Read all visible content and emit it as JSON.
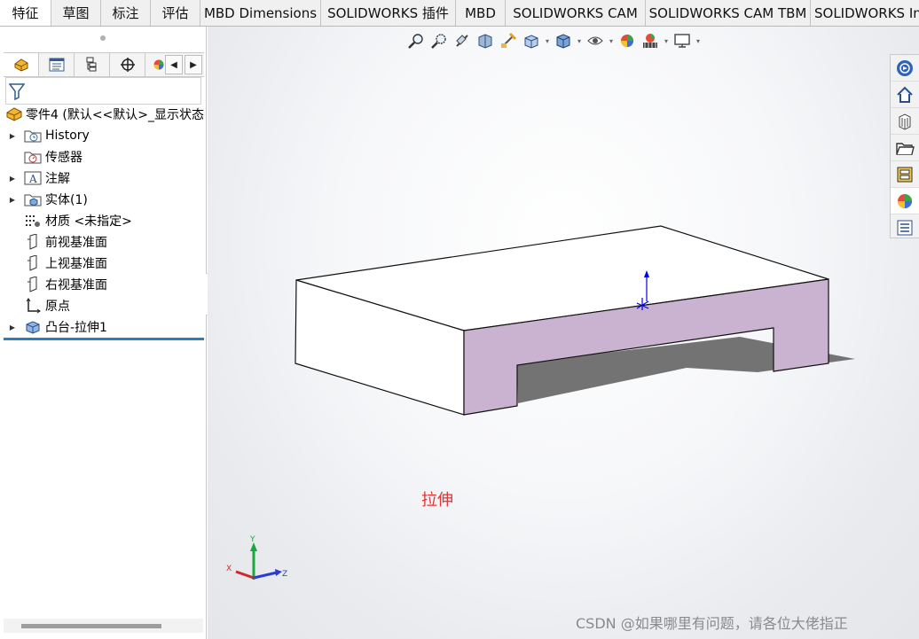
{
  "tabs": [
    {
      "label": "特征",
      "active": true
    },
    {
      "label": "草图"
    },
    {
      "label": "标注"
    },
    {
      "label": "评估"
    },
    {
      "label": "MBD Dimensions"
    },
    {
      "label": "SOLIDWORKS 插件"
    },
    {
      "label": "MBD"
    },
    {
      "label": "SOLIDWORKS CAM"
    },
    {
      "label": "SOLIDWORKS CAM TBM"
    },
    {
      "label": "SOLIDWORKS In..."
    }
  ],
  "panel": {
    "tab_icons": [
      "feature-manager-icon",
      "property-manager-icon",
      "configuration-manager-icon",
      "dimxpert-icon",
      "display-manager-icon"
    ],
    "root_label": "零件4  (默认<<默认>_显示状态",
    "items": [
      {
        "label": "History",
        "expandable": true,
        "icon": "history-folder-icon"
      },
      {
        "label": "传感器",
        "expandable": false,
        "icon": "sensor-folder-icon"
      },
      {
        "label": "注解",
        "expandable": true,
        "icon": "annotations-folder-icon"
      },
      {
        "label": "实体(1)",
        "expandable": true,
        "icon": "solid-bodies-folder-icon"
      },
      {
        "label": "材质 <未指定>",
        "expandable": false,
        "icon": "material-icon"
      },
      {
        "label": "前视基准面",
        "expandable": false,
        "icon": "plane-icon"
      },
      {
        "label": "上视基准面",
        "expandable": false,
        "icon": "plane-icon"
      },
      {
        "label": "右视基准面",
        "expandable": false,
        "icon": "plane-icon"
      },
      {
        "label": "原点",
        "expandable": false,
        "icon": "origin-icon"
      },
      {
        "label": "凸台-拉伸1",
        "expandable": true,
        "icon": "boss-extrude-icon"
      }
    ]
  },
  "headsup_toolbar": [
    "zoom-to-fit-icon",
    "zoom-to-area-icon",
    "previous-view-icon",
    "section-view-icon",
    "dynamic-annotation-icon",
    "view-orientation-icon",
    "display-style-icon",
    "hide-show-items-icon",
    "edit-appearance-icon",
    "apply-scene-icon",
    "view-settings-icon"
  ],
  "task_pane": [
    "solidworks-resources-icon",
    "home-icon",
    "design-library-icon",
    "file-explorer-icon",
    "view-palette-icon",
    "appearances-icon",
    "custom-properties-icon"
  ],
  "viewport": {
    "feature_label": "拉伸",
    "triad_labels": {
      "x": "X",
      "y": "Y",
      "z": "Z"
    }
  },
  "watermark": "CSDN @如果哪里有问题，请各位大佬指正",
  "colors": {
    "selected_face": "#c9b3d1",
    "feature_label": "#e53333",
    "rollback_bar": "#2d7cc0"
  }
}
